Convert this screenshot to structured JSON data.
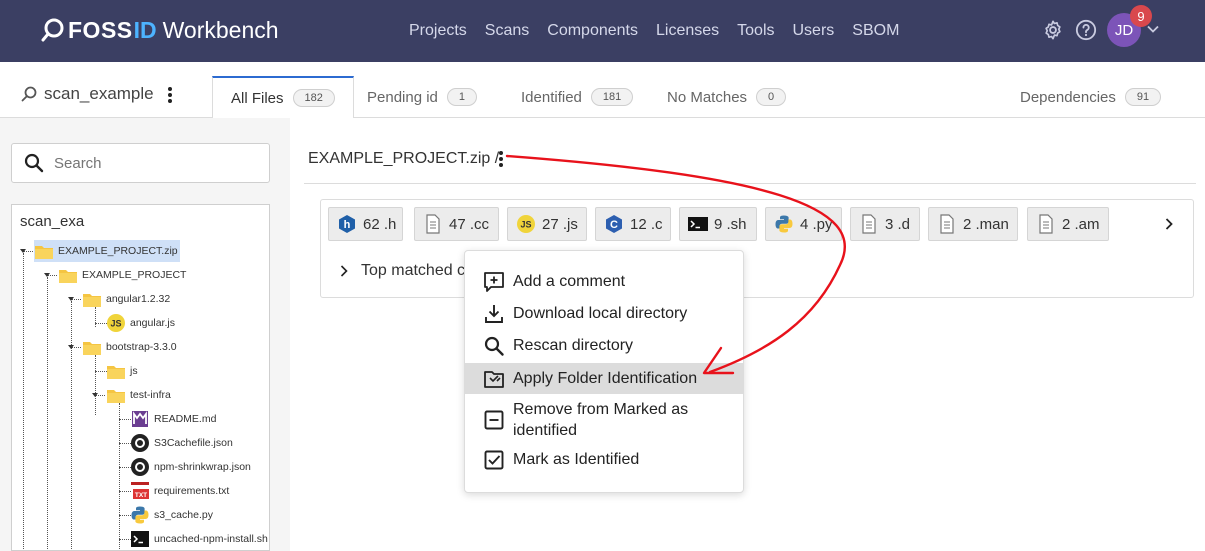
{
  "app": {
    "brand_part1": "FOSS",
    "brand_part2": "ID",
    "brand_part3": "Workbench",
    "nav": [
      "Projects",
      "Scans",
      "Components",
      "Licenses",
      "Tools",
      "Users",
      "SBOM"
    ],
    "user_initials": "JD",
    "notification_count": "9",
    "colors": {
      "topbar": "#3b3f63",
      "accent": "#2c6bd1",
      "avatar": "#7c54b8",
      "badge": "#d9484d",
      "arrow": "#e8121b"
    }
  },
  "scan": {
    "name": "scan_example"
  },
  "tabs": [
    {
      "label": "All Files",
      "count": "182",
      "active": true
    },
    {
      "label": "Pending id",
      "count": "1"
    },
    {
      "label": "Identified",
      "count": "181"
    },
    {
      "label": "No Matches",
      "count": "0"
    },
    {
      "label": "Dependencies",
      "count": "91"
    }
  ],
  "sidebar": {
    "search_placeholder": "Search",
    "tree_root": "scan_exa",
    "tree": [
      {
        "label": "EXAMPLE_PROJECT.zip",
        "icon": "folder-icon",
        "selected": true
      },
      {
        "label": "EXAMPLE_PROJECT",
        "icon": "folder-icon"
      },
      {
        "label": "angular1.2.32",
        "icon": "folder-icon"
      },
      {
        "label": "angular.js",
        "icon": "js-icon"
      },
      {
        "label": "bootstrap-3.3.0",
        "icon": "folder-icon"
      },
      {
        "label": "js",
        "icon": "folder-icon"
      },
      {
        "label": "test-infra",
        "icon": "folder-icon"
      },
      {
        "label": "README.md",
        "icon": "markdown-icon"
      },
      {
        "label": "S3Cachefile.json",
        "icon": "json-icon"
      },
      {
        "label": "npm-shrinkwrap.json",
        "icon": "json-icon"
      },
      {
        "label": "requirements.txt",
        "icon": "txt-icon"
      },
      {
        "label": "s3_cache.py",
        "icon": "python-icon"
      },
      {
        "label": "uncached-npm-install.sh",
        "icon": "terminal-icon"
      }
    ]
  },
  "main": {
    "breadcrumb": "EXAMPLE_PROJECT.zip /",
    "file_types": [
      {
        "count": "62",
        "ext": ".h",
        "icon": "h-file-icon"
      },
      {
        "count": "47",
        "ext": ".cc",
        "icon": "document-icon"
      },
      {
        "count": "27",
        "ext": ".js",
        "icon": "js-icon"
      },
      {
        "count": "12",
        "ext": ".c",
        "icon": "c-file-icon"
      },
      {
        "count": "9",
        "ext": ".sh",
        "icon": "terminal-icon"
      },
      {
        "count": "4",
        "ext": ".py",
        "icon": "python-icon"
      },
      {
        "count": "3",
        "ext": ".d",
        "icon": "document-icon"
      },
      {
        "count": "2",
        "ext": ".man",
        "icon": "document-icon"
      },
      {
        "count": "2",
        "ext": ".am",
        "icon": "document-icon"
      }
    ],
    "top_matched_label": "Top matched c"
  },
  "context_menu": [
    {
      "label": "Add a comment",
      "icon": "add-comment-icon"
    },
    {
      "label": "Download local directory",
      "icon": "download-icon"
    },
    {
      "label": "Rescan directory",
      "icon": "search-icon"
    },
    {
      "label": "Apply Folder Identification",
      "icon": "folder-apply-icon",
      "highlighted": true
    },
    {
      "label": "Remove from Marked as identified",
      "icon": "minus-box-icon"
    },
    {
      "label": "Mark as Identified",
      "icon": "checkbox-icon"
    }
  ]
}
